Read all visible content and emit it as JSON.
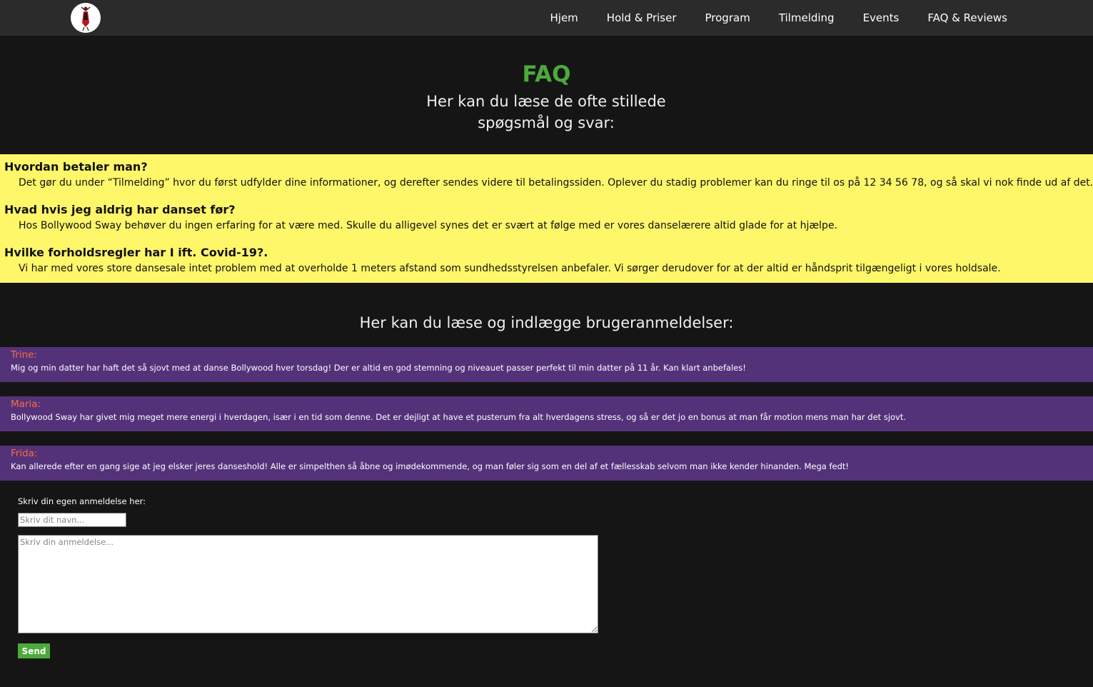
{
  "nav": {
    "logo_icon": "dancer-logo-icon",
    "links": [
      "Hjem",
      "Hold & Priser",
      "Program",
      "Tilmelding",
      "Events",
      "FAQ & Reviews"
    ]
  },
  "faq": {
    "title": "FAQ",
    "intro": "Her kan du læse de ofte stillede spøgsmål og svar:",
    "items": [
      {
        "question": "Hvordan betaler man?",
        "answer": "Det gør du under “Tilmelding” hvor du først udfylder dine informationer, og derefter sendes videre til betalingssiden. Oplever du stadig problemer kan du ringe til os på 12 34 56 78, og så skal vi nok finde ud af det."
      },
      {
        "question": "Hvad hvis jeg aldrig har danset før?",
        "answer": "Hos Bollywood Sway behøver du ingen erfaring for at være med. Skulle du alligevel synes det er svært at følge med er vores danselærere altid glade for at hjælpe."
      },
      {
        "question": "Hvilke forholdsregler har I ift. Covid-19?.",
        "answer": "Vi har med vores store dansesale intet problem med at overholde 1 meters afstand som sundhedsstyrelsen anbefaler. Vi sørger derudover for at der altid er håndsprit tilgængeligt i vores holdsale."
      }
    ]
  },
  "reviews": {
    "heading": "Her kan du læse og indlægge brugeranmeldelser:",
    "items": [
      {
        "name": "Trine:",
        "text": "Mig og min datter har haft det så sjovt med at danse Bollywood hver torsdag! Der er altid en god stemning og niveauet passer perfekt til min datter på 11 år. Kan klart anbefales!"
      },
      {
        "name": "Maria:",
        "text": "Bollywood Sway har givet mig meget mere energi i hverdagen, især i en tid som denne. Det er dejligt at have et pusterum fra alt hverdagens stress, og så er det jo en bonus at man får motion mens man har det sjovt."
      },
      {
        "name": "Frida:",
        "text": "Kan allerede efter en gang sige at jeg elsker jeres danseshold! Alle er simpelthen så åbne og imødekommende, og man føler sig som en del af et fællesskab selvom man ikke kender hinanden. Mega fedt!"
      }
    ]
  },
  "form": {
    "label": "Skriv din egen anmeldelse her:",
    "name_placeholder": "Skriv dit navn...",
    "review_placeholder": "Skriv din anmeldelse...",
    "send_label": "Send"
  },
  "colors": {
    "page_bg": "#151515",
    "nav_bg": "#2b2b2b",
    "accent_green": "#4caa3a",
    "faq_bg": "#fff76a",
    "review_bg": "#53327a",
    "review_name": "#ff6a3d"
  }
}
